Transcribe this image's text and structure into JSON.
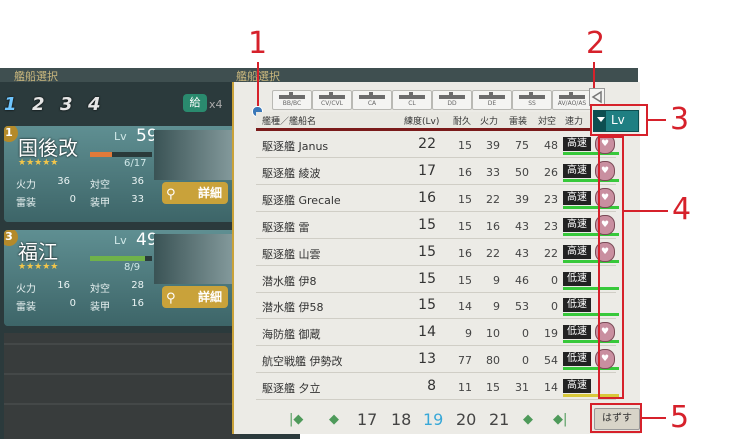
{
  "left_panel": {
    "title": "艦船選択",
    "fleet_tabs": [
      "1",
      "2",
      "3",
      "4"
    ],
    "supply_label": "給",
    "supply_count": "x4",
    "cards": [
      {
        "slot": "1",
        "name": "国後改",
        "lv_label": "Lv",
        "lv": "59",
        "stars": "★★★★★",
        "hp": "6/17",
        "hp_fraction": 0.35,
        "hp_color": "#e07a3a",
        "firepower_label": "火力",
        "firepower": "36",
        "aa_label": "対空",
        "aa": "36",
        "torpedo_label": "雷装",
        "torpedo": "0",
        "armor_label": "装甲",
        "armor": "33",
        "detail_label": "詳細"
      },
      {
        "slot": "3",
        "name": "福江",
        "lv_label": "Lv",
        "lv": "49",
        "stars": "★★★★★",
        "hp": "8/9",
        "hp_fraction": 0.89,
        "hp_color": "#6fb24a",
        "firepower_label": "火力",
        "firepower": "16",
        "aa_label": "対空",
        "aa": "28",
        "torpedo_label": "雷装",
        "torpedo": "0",
        "armor_label": "装甲",
        "armor": "16",
        "detail_label": "詳細"
      }
    ]
  },
  "selection_panel": {
    "title": "艦船選択",
    "type_filters": [
      "BB/BC",
      "CV/CVL",
      "CA",
      "CL",
      "DD",
      "DE",
      "SS",
      "AV/AO/AS"
    ],
    "columns": {
      "name": "艦種／艦船名",
      "lv": "練度(Lv)",
      "hp": "耐久",
      "firepower": "火力",
      "torpedo": "雷装",
      "aa": "対空",
      "speed": "速力"
    },
    "sort": {
      "label": "Lv"
    },
    "rows": [
      {
        "name": "駆逐艦 Janus",
        "lv": "22",
        "hp": "15",
        "fp": "39",
        "tp": "75",
        "aa": "48",
        "speed": "高速",
        "speed_color": "#37c83a",
        "locked": true
      },
      {
        "name": "駆逐艦 綾波",
        "lv": "17",
        "hp": "16",
        "fp": "33",
        "tp": "50",
        "aa": "26",
        "speed": "高速",
        "speed_color": "#37c83a",
        "locked": true
      },
      {
        "name": "駆逐艦 Grecale",
        "lv": "16",
        "hp": "15",
        "fp": "22",
        "tp": "39",
        "aa": "23",
        "speed": "高速",
        "speed_color": "#37c83a",
        "locked": true
      },
      {
        "name": "駆逐艦 雷",
        "lv": "15",
        "hp": "15",
        "fp": "16",
        "tp": "43",
        "aa": "23",
        "speed": "高速",
        "speed_color": "#37c83a",
        "locked": true
      },
      {
        "name": "駆逐艦 山雲",
        "lv": "15",
        "hp": "16",
        "fp": "22",
        "tp": "43",
        "aa": "22",
        "speed": "高速",
        "speed_color": "#37c83a",
        "locked": true
      },
      {
        "name": "潜水艦 伊8",
        "lv": "15",
        "hp": "15",
        "fp": "9",
        "tp": "46",
        "aa": "0",
        "speed": "低速",
        "speed_color": "#37c83a",
        "locked": false
      },
      {
        "name": "潜水艦 伊58",
        "lv": "15",
        "hp": "14",
        "fp": "9",
        "tp": "53",
        "aa": "0",
        "speed": "低速",
        "speed_color": "#37c83a",
        "locked": false
      },
      {
        "name": "海防艦 御蔵",
        "lv": "14",
        "hp": "9",
        "fp": "10",
        "tp": "0",
        "aa": "19",
        "speed": "低速",
        "speed_color": "#37c83a",
        "locked": true
      },
      {
        "name": "航空戦艦 伊勢改",
        "lv": "13",
        "hp": "77",
        "fp": "80",
        "tp": "0",
        "aa": "54",
        "speed": "低速",
        "speed_color": "#37c83a",
        "locked": true
      },
      {
        "name": "駆逐艦 夕立",
        "lv": "8",
        "hp": "11",
        "fp": "15",
        "tp": "31",
        "aa": "14",
        "speed": "高速",
        "speed_color": "#d8c83a",
        "locked": false
      }
    ],
    "pagination": {
      "pages": [
        "17",
        "18",
        "19",
        "20",
        "21"
      ],
      "current": "19",
      "first": "|◆",
      "prev": "◆",
      "next": "◆",
      "last": "◆|"
    },
    "remove_label": "はずす"
  },
  "annotations": [
    "1",
    "2",
    "3",
    "4",
    "5"
  ],
  "colors": {
    "accent": "#1f7f82",
    "annotation": "#d6212b",
    "header_rule": "#7a1b1b"
  }
}
